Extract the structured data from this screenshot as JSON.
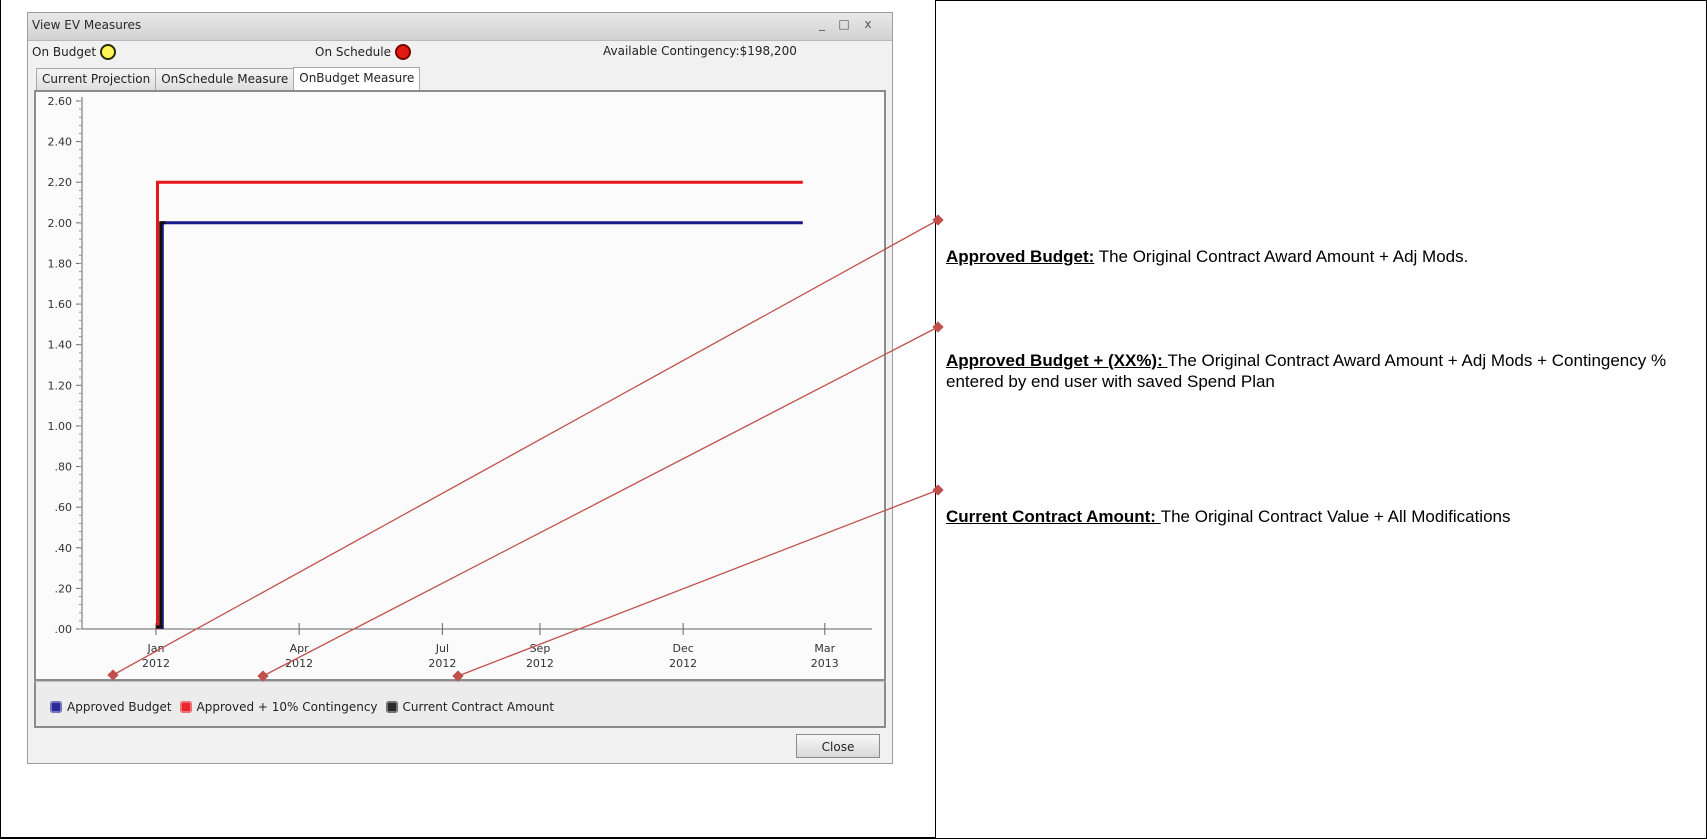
{
  "window": {
    "title": "View EV Measures",
    "controls": {
      "minimize": "_",
      "maximize": "□",
      "close": "x"
    },
    "status": {
      "on_budget_label": "On Budget",
      "on_budget_color": "#fff75a",
      "on_schedule_label": "On Schedule",
      "on_schedule_color": "#e11a12",
      "contingency": "Available Contingency:$198,200"
    },
    "tabs": [
      "Current Projection",
      "OnSchedule Measure",
      "OnBudget Measure"
    ],
    "active_tab": "OnBudget Measure",
    "close_label": "Close"
  },
  "chart_data": {
    "type": "line",
    "y_ticks": [
      "2.60",
      "2.40",
      "2.20",
      "2.00",
      "1.80",
      "1.60",
      "1.40",
      "1.20",
      "1.00",
      ".80",
      ".60",
      ".40",
      ".20",
      ".00"
    ],
    "ylim": [
      0,
      2.6
    ],
    "x_ticks": [
      {
        "month": "Jan",
        "year": "2012"
      },
      {
        "month": "Apr",
        "year": "2012"
      },
      {
        "month": "Jul",
        "year": "2012"
      },
      {
        "month": "Sep",
        "year": "2012"
      },
      {
        "month": "Dec",
        "year": "2012"
      },
      {
        "month": "Mar",
        "year": "2013"
      }
    ],
    "xlim": [
      "2011-11-15",
      "2013-03-31"
    ],
    "series": [
      {
        "name": "Approved + 10% Contingency",
        "color": "#e8161b",
        "points": [
          [
            "2012-01-02",
            0
          ],
          [
            "2012-01-02",
            2.2
          ],
          [
            "2013-02-15",
            2.2
          ]
        ]
      },
      {
        "name": "Approved Budget",
        "color": "#1a1a8c",
        "points": [
          [
            "2012-01-05",
            0
          ],
          [
            "2012-01-05",
            2.0
          ],
          [
            "2013-02-15",
            2.0
          ]
        ]
      },
      {
        "name": "Current Contract Amount",
        "color": "#111111",
        "points": [
          [
            "2012-01-01",
            0.01
          ],
          [
            "2012-01-04",
            0.01
          ],
          [
            "2012-01-04",
            2.0
          ],
          [
            "2012-01-07",
            2.0
          ]
        ]
      }
    ],
    "legend": [
      {
        "name": "Approved Budget",
        "color": "#2a2a9a"
      },
      {
        "name": "Approved + 10% Contingency",
        "color": "#e8262b"
      },
      {
        "name": "Current Contract Amount",
        "color": "#2a2a2a"
      }
    ]
  },
  "annotations": [
    {
      "term": "Approved Budget:",
      "text": " The Original Contract Award Amount + Adj Mods."
    },
    {
      "term": "Approved Budget + (XX%): ",
      "text": "The Original Contract Award Amount + Adj Mods + Contingency % entered by end user with saved Spend Plan"
    },
    {
      "term": "Current Contract Amount: ",
      "text": "The Original Contract Value + All Modifications"
    }
  ],
  "connector_color": "#c0504d"
}
